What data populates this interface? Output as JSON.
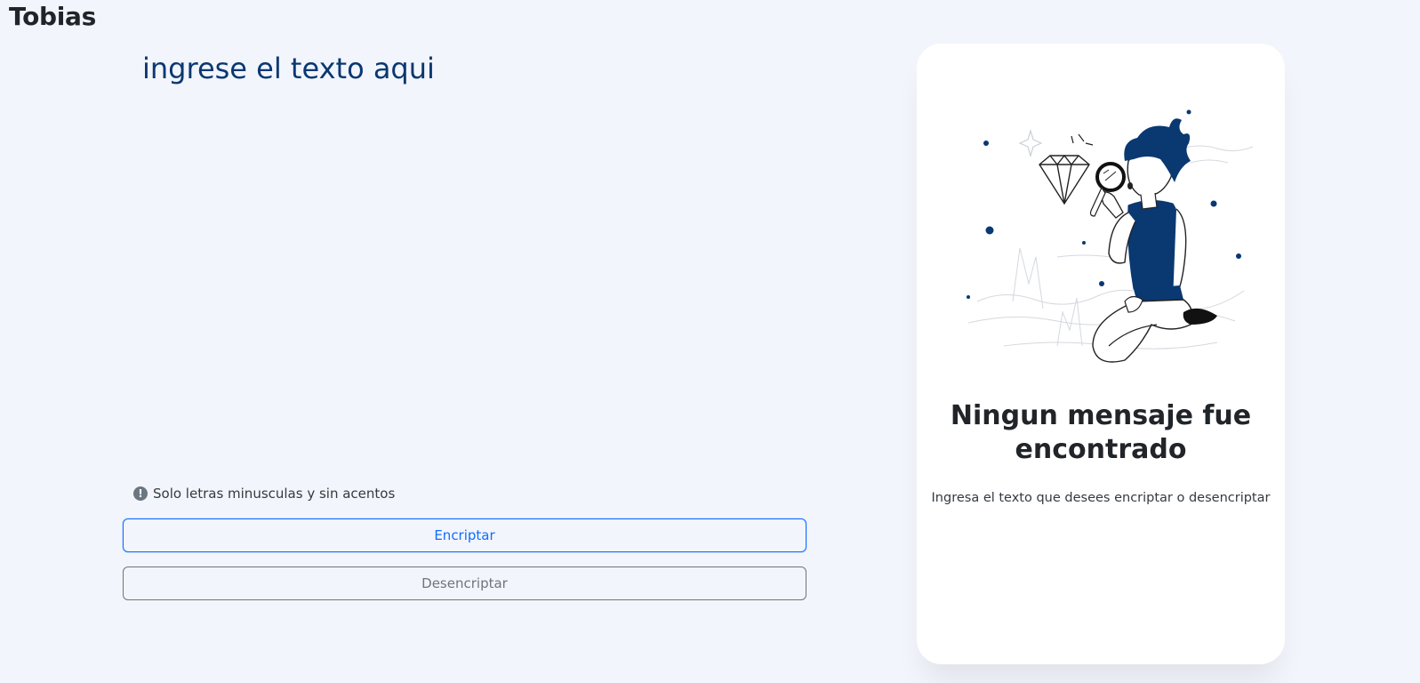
{
  "header": {
    "brand": "Tobias"
  },
  "editor": {
    "placeholder": "ingrese el texto aqui"
  },
  "hint": {
    "icon": "exclamation-circle-icon",
    "text": "Solo letras minusculas y sin acentos"
  },
  "actions": {
    "encrypt_label": "Encriptar",
    "decrypt_label": "Desencriptar"
  },
  "result_card": {
    "illustration": "person-with-magnifier-illustration",
    "title": "Ningun mensaje fue encontrado",
    "subtitle": "Ingresa el texto que desees encriptar o desencriptar"
  },
  "colors": {
    "background": "#f3f5fc",
    "accent": "#0a3871",
    "primary_button": "#0d6efd",
    "secondary_button": "#6c757d"
  }
}
